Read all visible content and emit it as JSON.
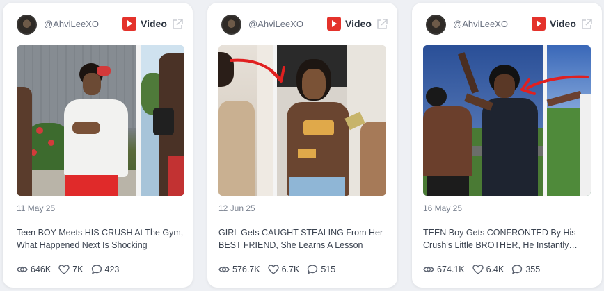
{
  "cards": [
    {
      "handle": "@AhviLeeXO",
      "platform": "Video",
      "date": "11 May 25",
      "title": "Teen BOY Meets HIS CRUSH At The Gym, What Happened Next Is Shocking",
      "views": "646K",
      "likes": "7K",
      "comments": "423"
    },
    {
      "handle": "@AhviLeeXO",
      "platform": "Video",
      "date": "12 Jun 25",
      "title": "GIRL Gets CAUGHT STEALING From Her BEST FRIEND, She Learns A Lesson",
      "views": "576.7K",
      "likes": "6.7K",
      "comments": "515"
    },
    {
      "handle": "@AhviLeeXO",
      "platform": "Video",
      "date": "16 May 25",
      "title": "TEEN Boy Gets CONFRONTED By His Crush's Little BROTHER, He Instantly…",
      "views": "674.1K",
      "likes": "6.4K",
      "comments": "355"
    }
  ],
  "colors": {
    "brand_red": "#e4322b",
    "arrow_red": "#e02020"
  },
  "icons": {
    "platform": "youtube-icon",
    "open": "external-link-icon",
    "views": "eye-icon",
    "likes": "heart-icon",
    "comments": "comment-icon"
  }
}
